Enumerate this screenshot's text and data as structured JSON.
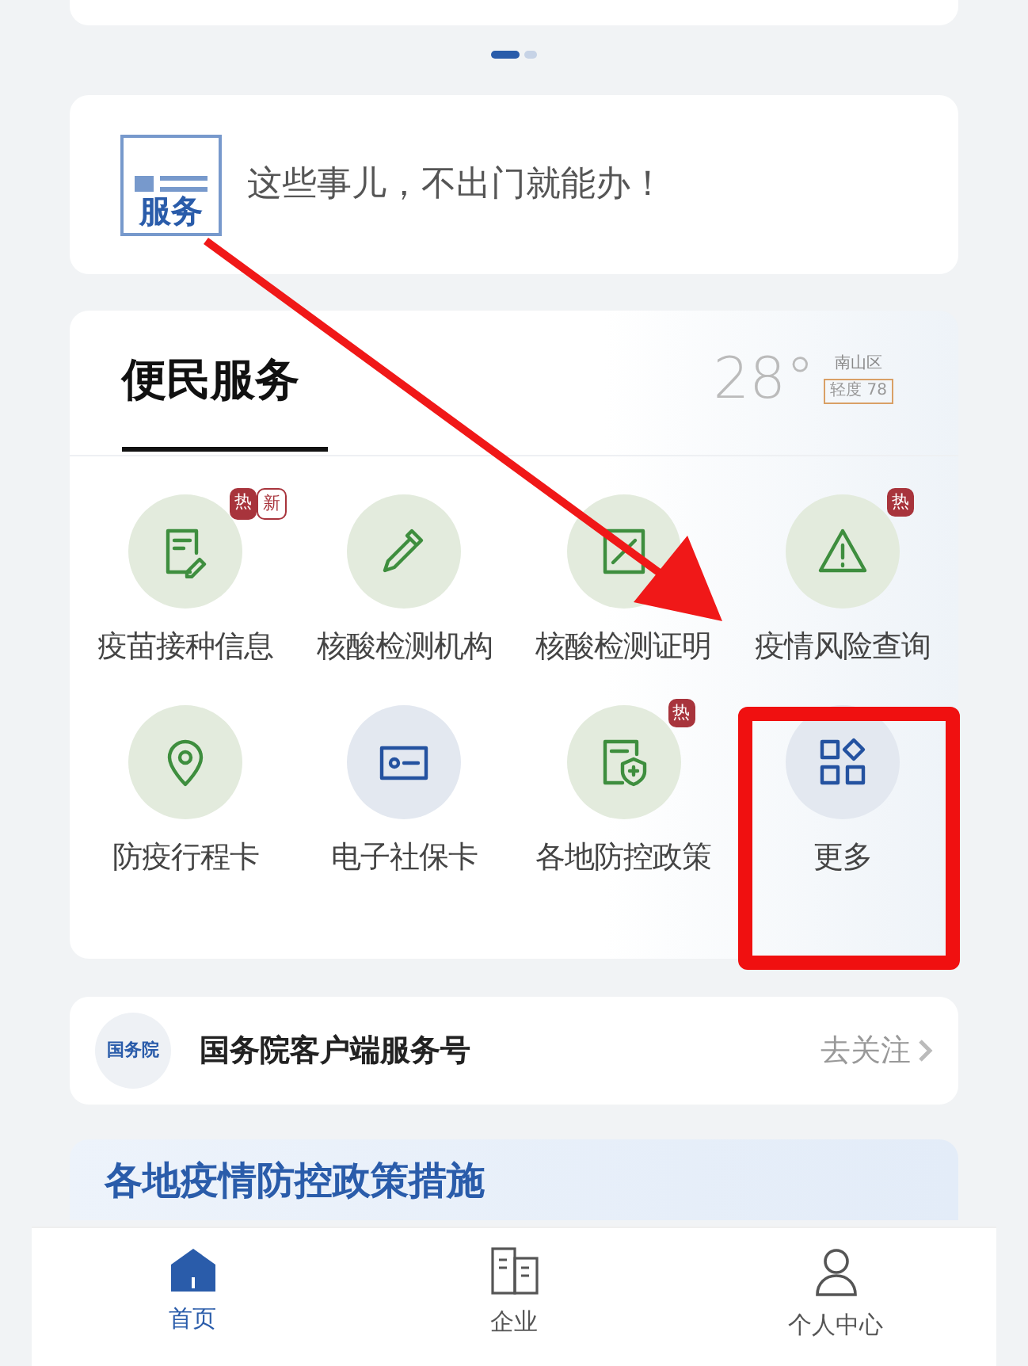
{
  "carousel": {
    "dots": [
      {
        "selected": true
      },
      {
        "selected": false
      }
    ]
  },
  "service_banner": {
    "logo": "服务",
    "text": "这些事儿，不出门就能办！"
  },
  "convenience": {
    "title": "便民服务",
    "weather": {
      "temperature": "28°",
      "district": "南山区",
      "air_quality": "轻度 78"
    },
    "items": [
      {
        "label": "疫苗接种信息",
        "badges": [
          {
            "text": "热",
            "kind": "hot"
          },
          {
            "text": "新",
            "kind": "new"
          }
        ]
      },
      {
        "label": "核酸检测机构"
      },
      {
        "label": "核酸检测证明"
      },
      {
        "label": "疫情风险查询",
        "badges": [
          {
            "text": "热",
            "kind": "hot"
          }
        ]
      },
      {
        "label": "防疫行程卡"
      },
      {
        "label": "电子社保卡"
      },
      {
        "label": "各地防控政策",
        "badges": [
          {
            "text": "热",
            "kind": "hot"
          }
        ]
      },
      {
        "label": "更多"
      }
    ]
  },
  "account": {
    "logo": "国务院",
    "name": "国务院客户端服务号",
    "action": "去关注"
  },
  "promo": {
    "heading": "各地疫情防控政策措施"
  },
  "tab_bar": [
    {
      "label": "首页",
      "selected": true
    },
    {
      "label": "企业",
      "selected": false
    },
    {
      "label": "个人中心",
      "selected": false
    }
  ]
}
